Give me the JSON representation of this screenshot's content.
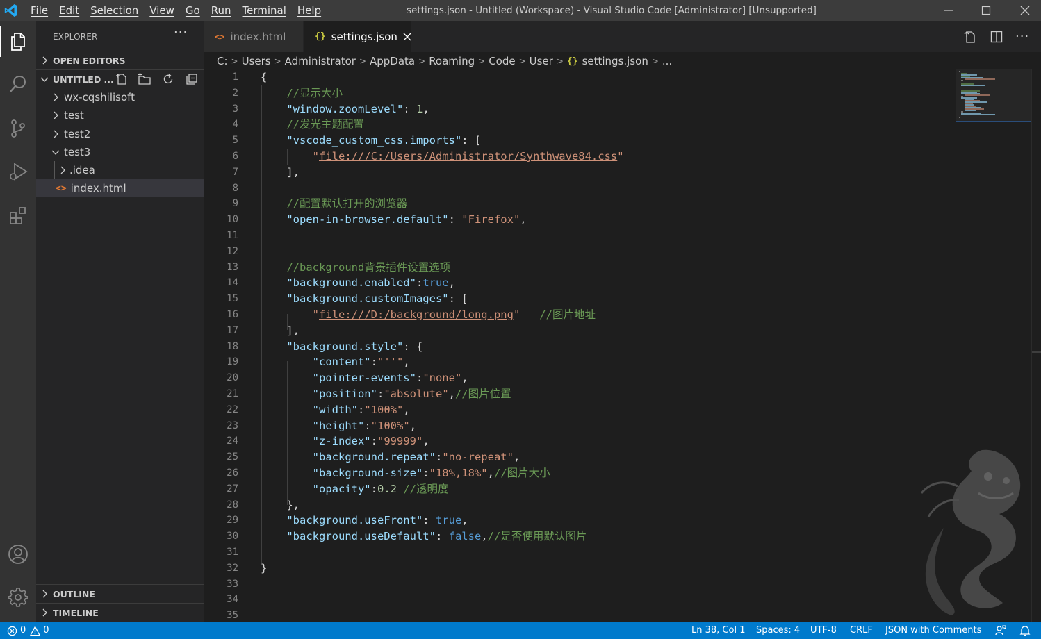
{
  "window": {
    "title": "settings.json - Untitled (Workspace) - Visual Studio Code [Administrator] [Unsupported]",
    "menu": [
      "File",
      "Edit",
      "Selection",
      "View",
      "Go",
      "Run",
      "Terminal",
      "Help"
    ]
  },
  "sidebar": {
    "title": "EXPLORER",
    "more": "···",
    "open_editors": "OPEN EDITORS",
    "workspace": "UNTITLED ...",
    "tree": [
      {
        "label": "wx-cqshilisoft",
        "type": "folder"
      },
      {
        "label": "test",
        "type": "folder"
      },
      {
        "label": "test2",
        "type": "folder"
      },
      {
        "label": "test3",
        "type": "folder-open"
      },
      {
        "label": ".idea",
        "type": "folder"
      },
      {
        "label": "index.html",
        "type": "file-html"
      }
    ],
    "outline": "OUTLINE",
    "timeline": "TIMELINE"
  },
  "tabs": [
    {
      "label": "index.html",
      "active": false
    },
    {
      "label": "settings.json",
      "active": true
    }
  ],
  "breadcrumb": [
    "C:",
    "Users",
    "Administrator",
    "AppData",
    "Roaming",
    "Code",
    "User",
    "settings.json",
    "..."
  ],
  "editor": {
    "line_numbers": [
      "1",
      "2",
      "3",
      "4",
      "5",
      "6",
      "7",
      "8",
      "9",
      "10",
      "11",
      "12",
      "13",
      "14",
      "15",
      "16",
      "17",
      "18",
      "19",
      "20",
      "21",
      "22",
      "23",
      "24",
      "25",
      "26",
      "27",
      "28",
      "29",
      "30",
      "31",
      "32",
      "33",
      "34",
      "35"
    ],
    "lines": [
      [
        {
          "t": "{",
          "c": ""
        }
      ],
      [
        {
          "t": "    //显示大小",
          "c": "c"
        }
      ],
      [
        {
          "t": "    ",
          "c": ""
        },
        {
          "t": "\"window.zoomLevel\"",
          "c": "k"
        },
        {
          "t": ": ",
          "c": ""
        },
        {
          "t": "1",
          "c": "n"
        },
        {
          "t": ",",
          "c": ""
        }
      ],
      [
        {
          "t": "    //发光主题配置",
          "c": "c"
        }
      ],
      [
        {
          "t": "    ",
          "c": ""
        },
        {
          "t": "\"vscode_custom_css.imports\"",
          "c": "k"
        },
        {
          "t": ": [",
          "c": ""
        }
      ],
      [
        {
          "t": "        ",
          "c": ""
        },
        {
          "t": "\"",
          "c": "s"
        },
        {
          "t": "file:///C:/Users/Administrator/Synthwave84.css",
          "c": "s u"
        },
        {
          "t": "\"",
          "c": "s"
        }
      ],
      [
        {
          "t": "    ],",
          "c": ""
        }
      ],
      [],
      [
        {
          "t": "    //配置默认打开的浏览器",
          "c": "c"
        }
      ],
      [
        {
          "t": "    ",
          "c": ""
        },
        {
          "t": "\"open-in-browser.default\"",
          "c": "k"
        },
        {
          "t": ": ",
          "c": ""
        },
        {
          "t": "\"Firefox\"",
          "c": "s"
        },
        {
          "t": ",",
          "c": ""
        }
      ],
      [],
      [],
      [
        {
          "t": "    //background背景插件设置选项",
          "c": "c"
        }
      ],
      [
        {
          "t": "    ",
          "c": ""
        },
        {
          "t": "\"background.enabled\"",
          "c": "k"
        },
        {
          "t": ":",
          "c": ""
        },
        {
          "t": "true",
          "c": "b"
        },
        {
          "t": ",",
          "c": ""
        }
      ],
      [
        {
          "t": "    ",
          "c": ""
        },
        {
          "t": "\"background.customImages\"",
          "c": "k"
        },
        {
          "t": ": [",
          "c": ""
        }
      ],
      [
        {
          "t": "        ",
          "c": ""
        },
        {
          "t": "\"",
          "c": "s"
        },
        {
          "t": "file:///D:/background/long.png",
          "c": "s u"
        },
        {
          "t": "\"",
          "c": "s"
        },
        {
          "t": "   //图片地址",
          "c": "c"
        }
      ],
      [
        {
          "t": "    ],",
          "c": ""
        }
      ],
      [
        {
          "t": "    ",
          "c": ""
        },
        {
          "t": "\"background.style\"",
          "c": "k"
        },
        {
          "t": ": {",
          "c": ""
        }
      ],
      [
        {
          "t": "        ",
          "c": ""
        },
        {
          "t": "\"content\"",
          "c": "k"
        },
        {
          "t": ":",
          "c": ""
        },
        {
          "t": "\"''\"",
          "c": "s"
        },
        {
          "t": ",",
          "c": ""
        }
      ],
      [
        {
          "t": "        ",
          "c": ""
        },
        {
          "t": "\"pointer-events\"",
          "c": "k"
        },
        {
          "t": ":",
          "c": ""
        },
        {
          "t": "\"none\"",
          "c": "s"
        },
        {
          "t": ",",
          "c": ""
        }
      ],
      [
        {
          "t": "        ",
          "c": ""
        },
        {
          "t": "\"position\"",
          "c": "k"
        },
        {
          "t": ":",
          "c": ""
        },
        {
          "t": "\"absolute\"",
          "c": "s"
        },
        {
          "t": ",",
          "c": ""
        },
        {
          "t": "//图片位置",
          "c": "c"
        }
      ],
      [
        {
          "t": "        ",
          "c": ""
        },
        {
          "t": "\"width\"",
          "c": "k"
        },
        {
          "t": ":",
          "c": ""
        },
        {
          "t": "\"100%\"",
          "c": "s"
        },
        {
          "t": ",",
          "c": ""
        }
      ],
      [
        {
          "t": "        ",
          "c": ""
        },
        {
          "t": "\"height\"",
          "c": "k"
        },
        {
          "t": ":",
          "c": ""
        },
        {
          "t": "\"100%\"",
          "c": "s"
        },
        {
          "t": ",",
          "c": ""
        }
      ],
      [
        {
          "t": "        ",
          "c": ""
        },
        {
          "t": "\"z-index\"",
          "c": "k"
        },
        {
          "t": ":",
          "c": ""
        },
        {
          "t": "\"99999\"",
          "c": "s"
        },
        {
          "t": ",",
          "c": ""
        }
      ],
      [
        {
          "t": "        ",
          "c": ""
        },
        {
          "t": "\"background.repeat\"",
          "c": "k"
        },
        {
          "t": ":",
          "c": ""
        },
        {
          "t": "\"no-repeat\"",
          "c": "s"
        },
        {
          "t": ",",
          "c": ""
        }
      ],
      [
        {
          "t": "        ",
          "c": ""
        },
        {
          "t": "\"background-size\"",
          "c": "k"
        },
        {
          "t": ":",
          "c": ""
        },
        {
          "t": "\"18%,18%\"",
          "c": "s"
        },
        {
          "t": ",",
          "c": ""
        },
        {
          "t": "//图片大小",
          "c": "c"
        }
      ],
      [
        {
          "t": "        ",
          "c": ""
        },
        {
          "t": "\"opacity\"",
          "c": "k"
        },
        {
          "t": ":",
          "c": ""
        },
        {
          "t": "0.2",
          "c": "n"
        },
        {
          "t": " ",
          "c": ""
        },
        {
          "t": "//透明度",
          "c": "c"
        }
      ],
      [
        {
          "t": "    },",
          "c": ""
        }
      ],
      [
        {
          "t": "    ",
          "c": ""
        },
        {
          "t": "\"background.useFront\"",
          "c": "k"
        },
        {
          "t": ": ",
          "c": ""
        },
        {
          "t": "true",
          "c": "b"
        },
        {
          "t": ",",
          "c": ""
        }
      ],
      [
        {
          "t": "    ",
          "c": ""
        },
        {
          "t": "\"background.useDefault\"",
          "c": "k"
        },
        {
          "t": ": ",
          "c": ""
        },
        {
          "t": "false",
          "c": "b"
        },
        {
          "t": ",",
          "c": ""
        },
        {
          "t": "//是否使用默认图片",
          "c": "c"
        }
      ],
      [],
      [
        {
          "t": "}",
          "c": ""
        }
      ],
      [],
      [],
      []
    ]
  },
  "status": {
    "errors": "0",
    "warnings": "0",
    "position": "Ln 38, Col 1",
    "spaces": "Spaces: 4",
    "encoding": "UTF-8",
    "eol": "CRLF",
    "language": "JSON with Comments"
  },
  "colors": {
    "accent": "#007acc",
    "vscode_logo": "#23a9f2",
    "html_icon": "#e37933",
    "json_icon": "#cbcb41"
  }
}
